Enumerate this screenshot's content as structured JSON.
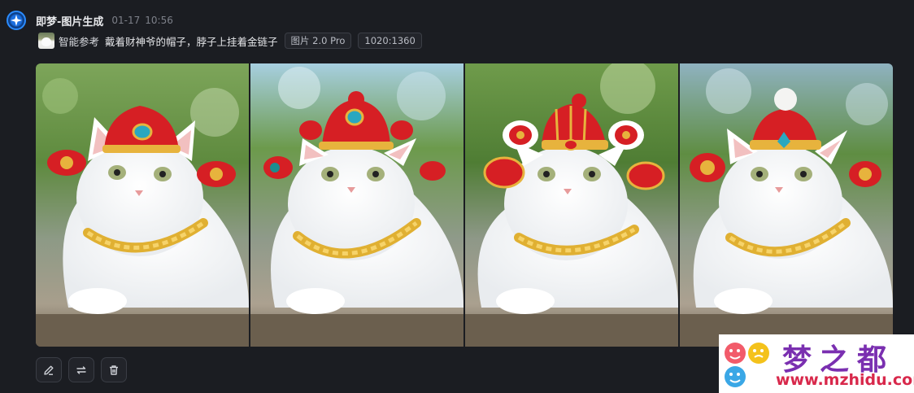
{
  "header": {
    "app_icon": "sparkle-icon",
    "app_name": "即梦-图片生成",
    "date": "01-17",
    "time": "10:56"
  },
  "prompt": {
    "reference_label": "智能参考",
    "text": "戴着财神爷的帽子，脖子上挂着金链子",
    "tags": [
      "图片 2.0 Pro",
      "1020:1360"
    ]
  },
  "actions": [
    {
      "name": "edit-button",
      "icon": "pencil-icon"
    },
    {
      "name": "regenerate-button",
      "icon": "refresh-icon"
    },
    {
      "name": "delete-button",
      "icon": "trash-icon"
    }
  ],
  "watermark": {
    "title": "梦之都",
    "url": "www.mzhidu.com"
  }
}
